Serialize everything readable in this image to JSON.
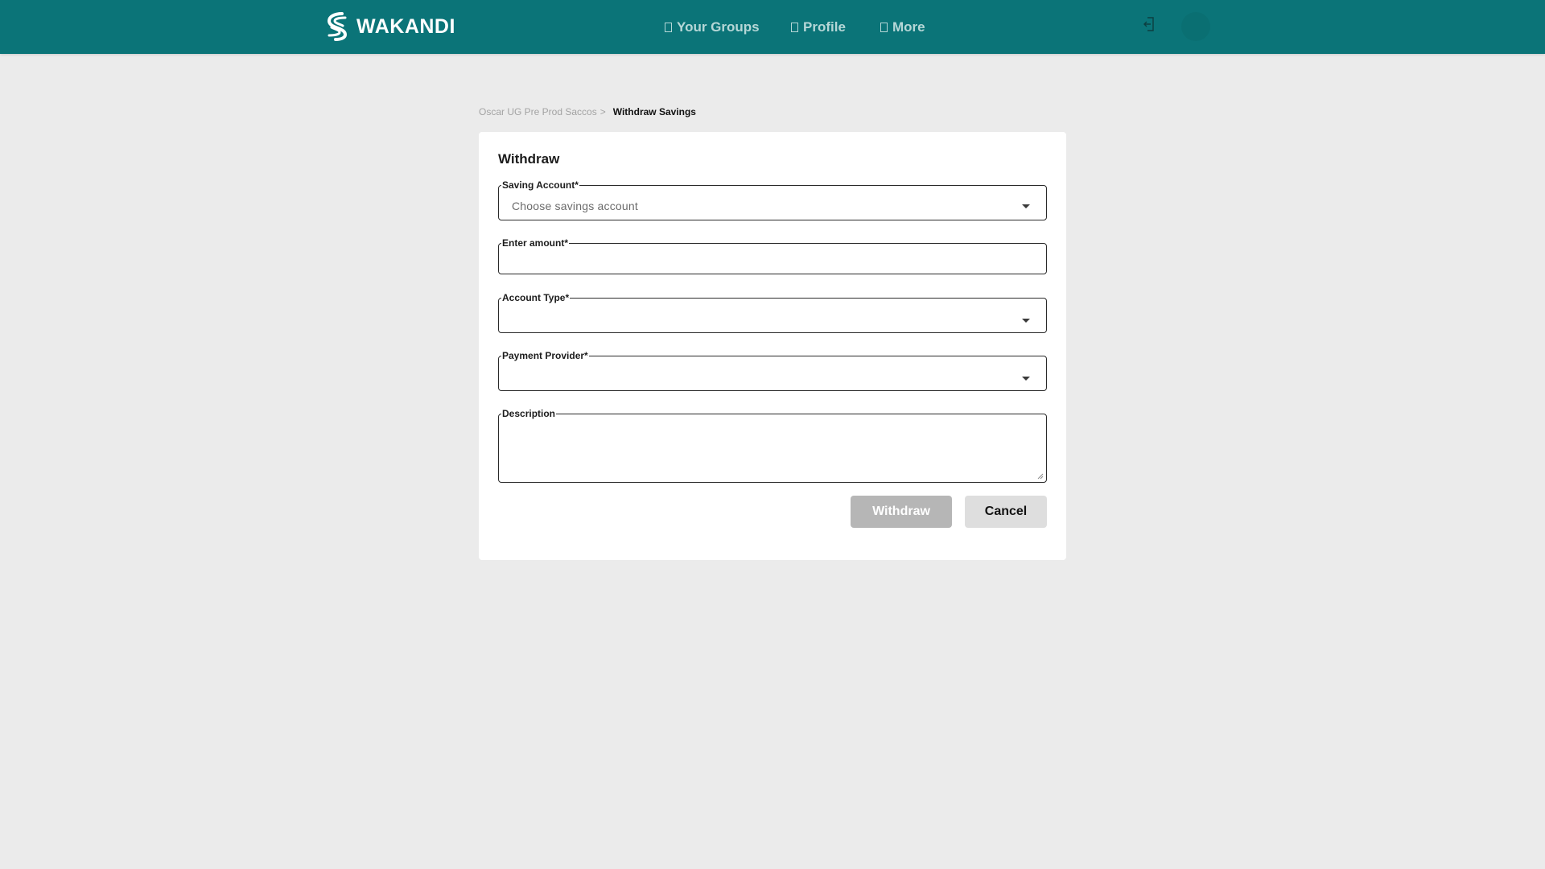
{
  "header": {
    "brand": "WAKANDI",
    "logo_icon": "wakandi-s-logo",
    "nav": [
      {
        "label": "Your Groups",
        "icon": "groups-icon"
      },
      {
        "label": "Profile",
        "icon": "profile-icon"
      },
      {
        "label": "More",
        "icon": "more-icon"
      }
    ],
    "logout_icon": "logout-icon",
    "colors": {
      "bar": "#0b7478",
      "nav_text": "#b6d7d7"
    }
  },
  "breadcrumb": {
    "parent": "Oscar UG Pre Prod Saccos",
    "separator": ">",
    "current": "Withdraw Savings"
  },
  "form": {
    "title": "Withdraw",
    "saving_account": {
      "label": "Saving Account*",
      "placeholder": "Choose savings account",
      "value": ""
    },
    "amount": {
      "label": "Enter amount*",
      "value": ""
    },
    "account_type": {
      "label": "Account Type*",
      "value": ""
    },
    "payment_provider": {
      "label": "Payment Provider*",
      "value": ""
    },
    "description": {
      "label": "Description",
      "value": ""
    },
    "withdraw_button": "Withdraw",
    "cancel_button": "Cancel"
  }
}
